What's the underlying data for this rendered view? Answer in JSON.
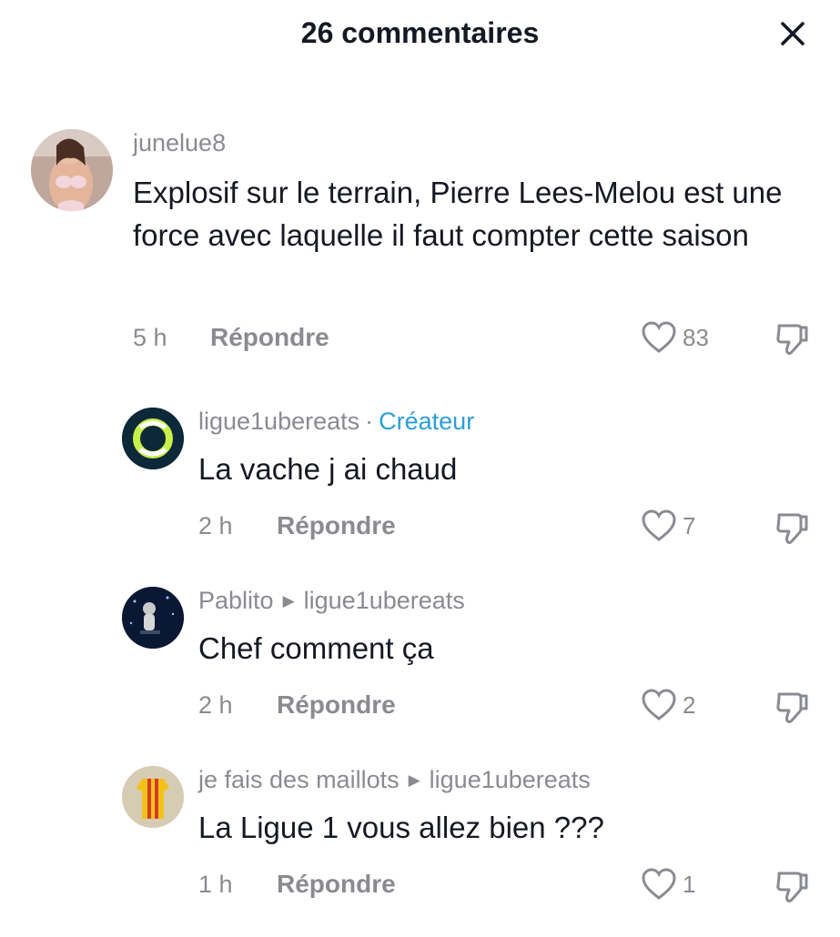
{
  "header": {
    "title": "26 commentaires",
    "close_icon": "close-icon"
  },
  "accent": {
    "creator_color": "#2a9fd8",
    "muted_color": "#8a8b91",
    "text_color": "#161823"
  },
  "comments": [
    {
      "username": "junelue8",
      "text": "Explosif sur le terrain, Pierre Lees-Melou est une force avec laquelle il faut compter cette saison",
      "time": "5 h",
      "reply_label": "Répondre",
      "likes": "83"
    },
    {
      "username": "ligue1ubereats",
      "separator": "·",
      "badge": "Créateur",
      "text": "La vache j ai chaud",
      "time": "2 h",
      "reply_label": "Répondre",
      "likes": "7"
    },
    {
      "username": "Pablito",
      "reply_to": "ligue1ubereats",
      "text": "Chef comment ça",
      "time": "2 h",
      "reply_label": "Répondre",
      "likes": "2"
    },
    {
      "username": "je fais des maillots",
      "reply_to": "ligue1ubereats",
      "text": "La Ligue 1 vous allez bien ???",
      "time": "1 h",
      "reply_label": "Répondre",
      "likes": "1"
    }
  ]
}
